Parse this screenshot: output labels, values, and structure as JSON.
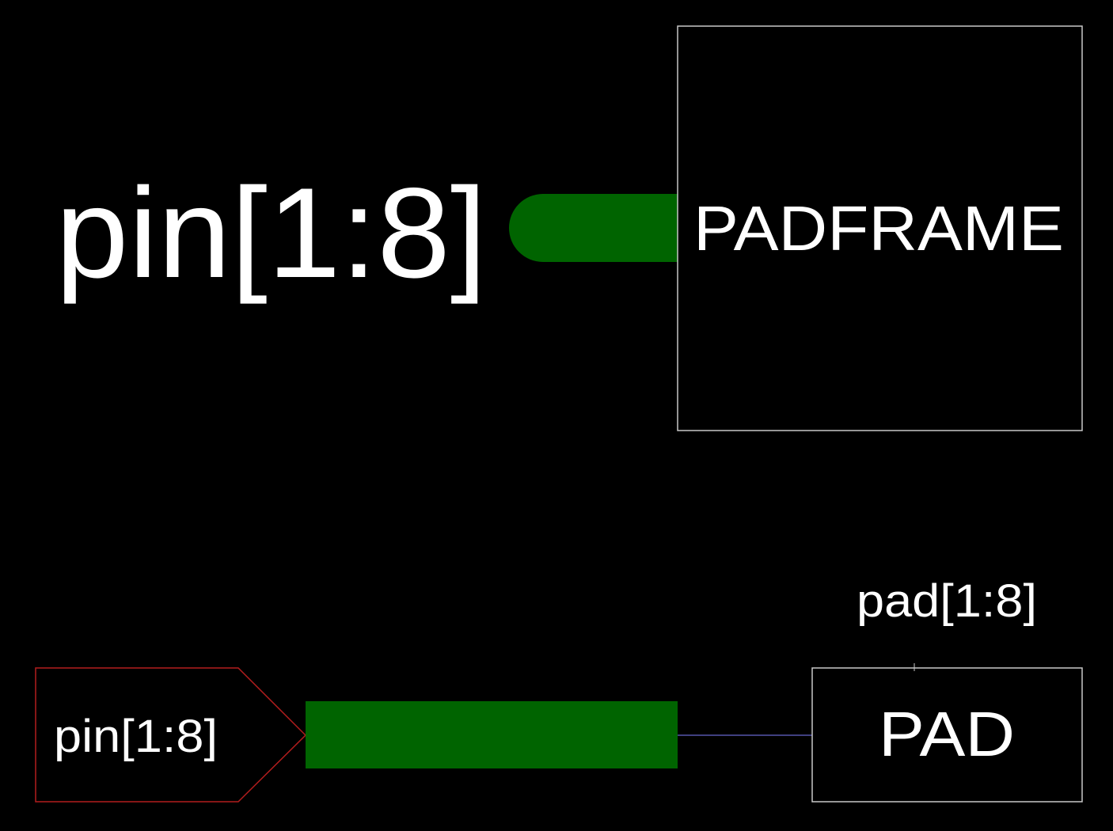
{
  "colors": {
    "background": "#000000",
    "bus_wire": "#006400",
    "thin_wire": "#5555aa",
    "text": "#ffffff",
    "box_outline": "#c8c8c8",
    "port_outline": "#b21d1d"
  },
  "top": {
    "bus_label": "pin[1:8]",
    "block_label": "PADFRAME"
  },
  "bottom": {
    "port_label": "pin[1:8]",
    "pad_label": "PAD",
    "pad_net_label": "pad[1:8]"
  }
}
